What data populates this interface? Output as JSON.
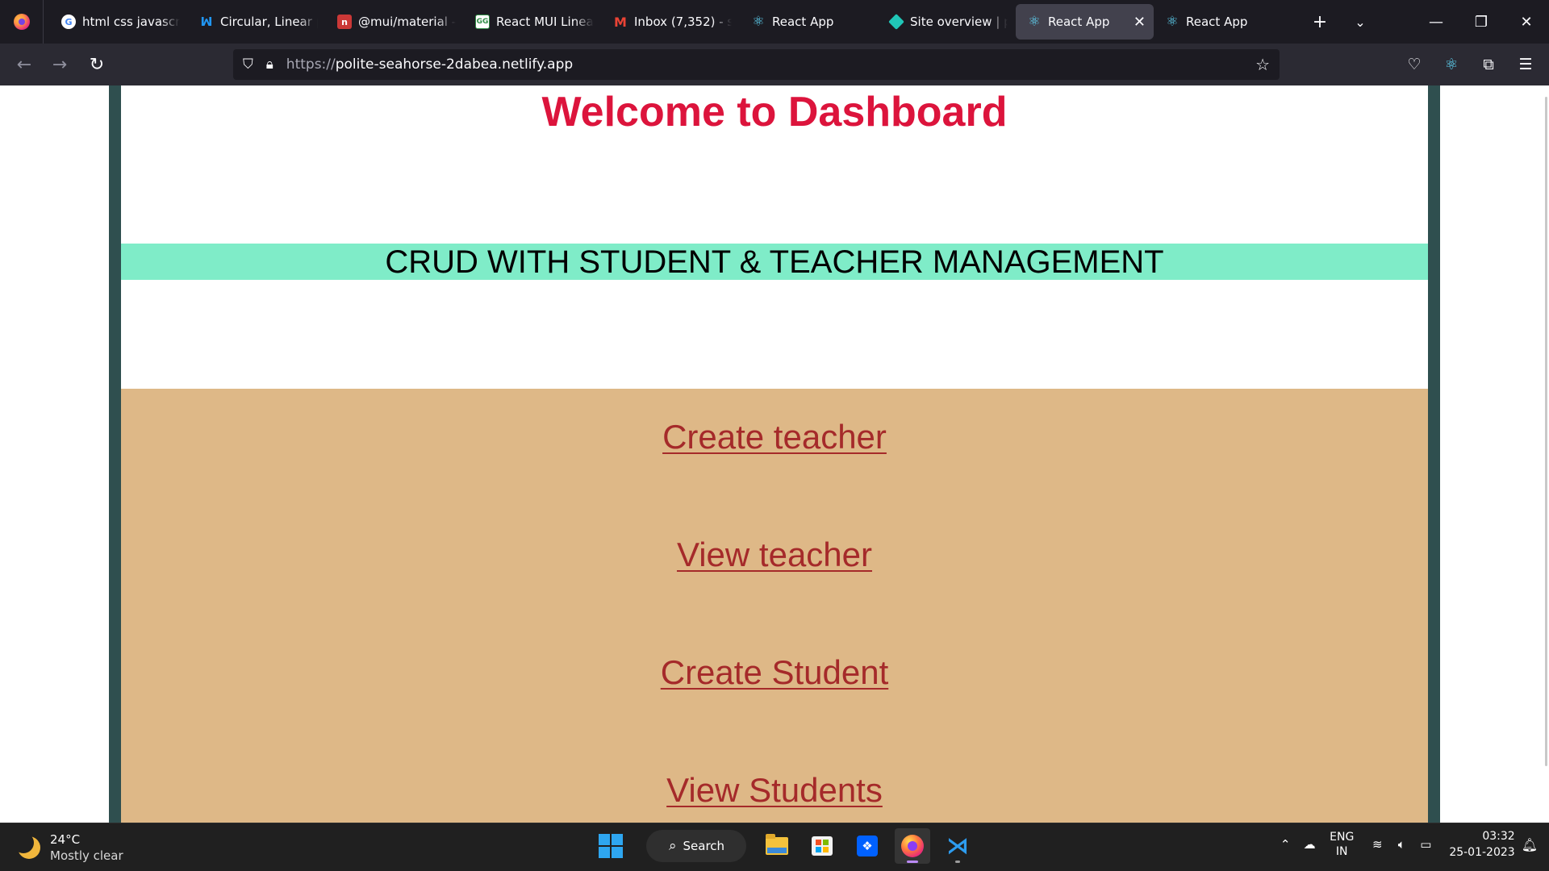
{
  "browser": {
    "tabs": [
      {
        "label": "html css javascript",
        "favicon": "google-icon",
        "active": false
      },
      {
        "label": "Circular, Linear pr",
        "favicon": "mui-icon",
        "active": false
      },
      {
        "label": "@mui/material - n",
        "favicon": "npm-icon",
        "active": false
      },
      {
        "label": "React MUI Linear",
        "favicon": "geeksforgeeks-icon",
        "active": false
      },
      {
        "label": "Inbox (7,352) - sb",
        "favicon": "gmail-icon",
        "active": false
      },
      {
        "label": "React App",
        "favicon": "react-icon",
        "active": false
      },
      {
        "label": "Site overview | po",
        "favicon": "netlify-icon",
        "active": false
      },
      {
        "label": "React App",
        "favicon": "react-icon",
        "active": true
      },
      {
        "label": "React App",
        "favicon": "react-icon",
        "active": false
      }
    ],
    "url_scheme": "https://",
    "url_host": "polite-seahorse-2dabea.netlify.app"
  },
  "page": {
    "title": "Welcome to Dashboard",
    "banner": "CRUD WITH STUDENT & TEACHER MANAGEMENT",
    "links": [
      "Create teacher",
      "View teacher",
      "Create Student",
      "View Students"
    ],
    "colors": {
      "title": "#dc143c",
      "banner_bg": "#7fecc8",
      "links_bg": "#deb887",
      "link_text": "#a52a2a",
      "frame": "#2f4f4f"
    }
  },
  "taskbar": {
    "weather_temp": "24°C",
    "weather_desc": "Mostly clear",
    "search_label": "Search",
    "lang_line1": "ENG",
    "lang_line2": "IN",
    "time": "03:32",
    "date": "25-01-2023"
  }
}
